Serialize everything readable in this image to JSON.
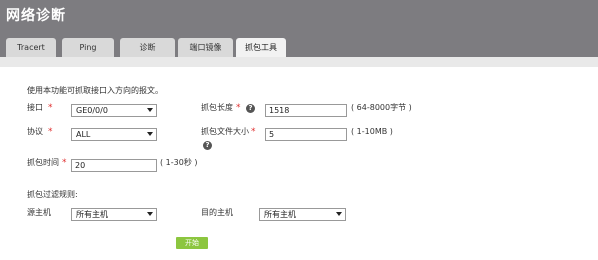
{
  "page": {
    "title": "网络诊断"
  },
  "tabs": [
    {
      "label": "Tracert"
    },
    {
      "label": "Ping"
    },
    {
      "label": "诊断"
    },
    {
      "label": "端口镜像"
    },
    {
      "label": "抓包工具"
    }
  ],
  "form": {
    "description": "使用本功能可抓取接口入方向的报文。",
    "required_mark": "*",
    "interface": {
      "label": "接口",
      "value": "GE0/0/0"
    },
    "protocol": {
      "label": "协议",
      "value": "ALL"
    },
    "capture_length": {
      "label": "抓包长度",
      "value": "1518",
      "hint": "( 64-8000字节 )"
    },
    "capture_file_size": {
      "label": "抓包文件大小",
      "value": "5",
      "hint": "( 1-10MB )"
    },
    "capture_time": {
      "label": "抓包时间",
      "value": "20",
      "hint": "( 1-30秒 )"
    },
    "filter_title": "抓包过滤规则:",
    "source_host": {
      "label": "源主机",
      "value": "所有主机"
    },
    "dest_host": {
      "label": "目的主机",
      "value": "所有主机"
    },
    "start_button": "开始",
    "help_glyph": "?"
  },
  "colors": {
    "header_bg": "#7d7c80",
    "tab_bg": "#d9d9d9",
    "tab_active_bg": "#f2f2f2",
    "required": "#e03030",
    "start_button": "#8cc63f"
  }
}
